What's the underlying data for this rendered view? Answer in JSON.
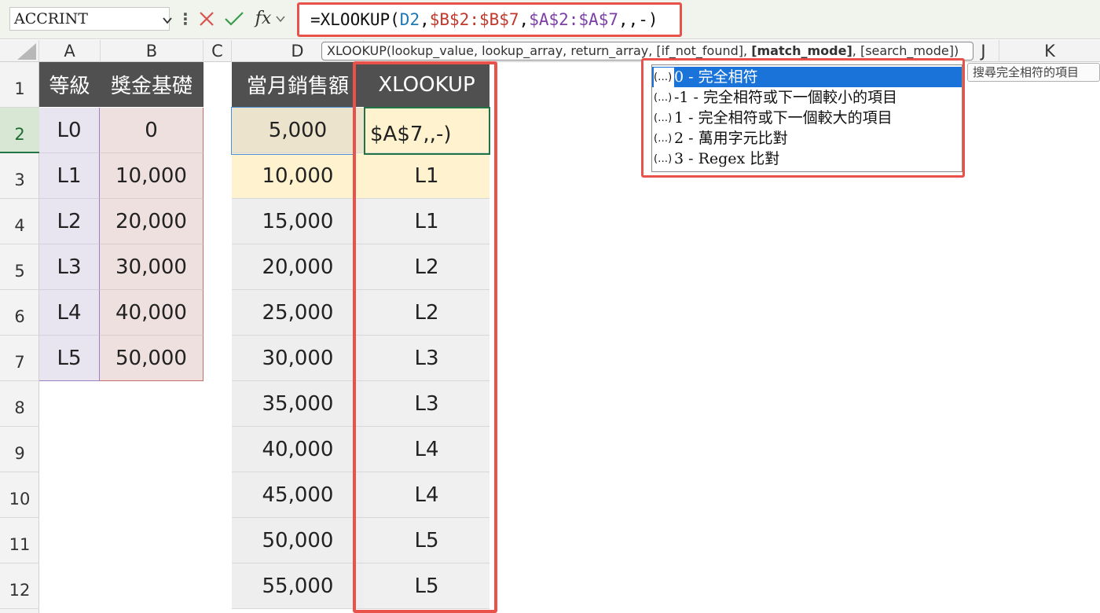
{
  "formula_bar": {
    "name_box": "ACCRINT",
    "more_icon": "⋮",
    "cancel_icon": "close-icon",
    "enter_icon": "check-icon",
    "fx_label": "fx",
    "formula_parts": [
      "=XLOOKUP(",
      "D2",
      ",",
      "$B$2:$B$7",
      ",",
      "$A$2:$A$7",
      ",,-)"
    ]
  },
  "columns": [
    "A",
    "B",
    "C",
    "D",
    "J",
    "K"
  ],
  "rows": [
    "1",
    "2",
    "3",
    "4",
    "5",
    "6",
    "7",
    "8",
    "9",
    "10",
    "11",
    "12"
  ],
  "active_row": "2",
  "table1": {
    "headers": [
      "等級",
      "獎金基礎"
    ],
    "rows": [
      [
        "L0",
        "0"
      ],
      [
        "L1",
        "10,000"
      ],
      [
        "L2",
        "20,000"
      ],
      [
        "L3",
        "30,000"
      ],
      [
        "L4",
        "40,000"
      ],
      [
        "L5",
        "50,000"
      ]
    ]
  },
  "table2": {
    "headers": [
      "當月銷售額",
      "XLOOKUP"
    ],
    "editing_cell_text": "$A$7,,-)",
    "editing_cell_partial_top": "(\\ , \\) ,",
    "rows": [
      [
        "5,000",
        ""
      ],
      [
        "10,000",
        "L1"
      ],
      [
        "15,000",
        "L1"
      ],
      [
        "20,000",
        "L2"
      ],
      [
        "25,000",
        "L2"
      ],
      [
        "30,000",
        "L3"
      ],
      [
        "35,000",
        "L3"
      ],
      [
        "40,000",
        "L4"
      ],
      [
        "45,000",
        "L4"
      ],
      [
        "50,000",
        "L5"
      ],
      [
        "55,000",
        "L5"
      ]
    ]
  },
  "tooltip": {
    "prefix": "XLOOKUP(lookup_value, lookup_array, return_array, [if_not_found], ",
    "bold": "[match_mode]",
    "suffix": ", [search_mode])"
  },
  "dropdown": {
    "icon": "(…)",
    "items": [
      "0  -  完全相符",
      "-1  -  完全相符或下一個較小的項目",
      "1  -  完全相符或下一個較大的項目",
      "2  -  萬用字元比對",
      "3  -  Regex 比對"
    ],
    "selected_index": 0,
    "hint": "搜尋完全相符的項目"
  }
}
